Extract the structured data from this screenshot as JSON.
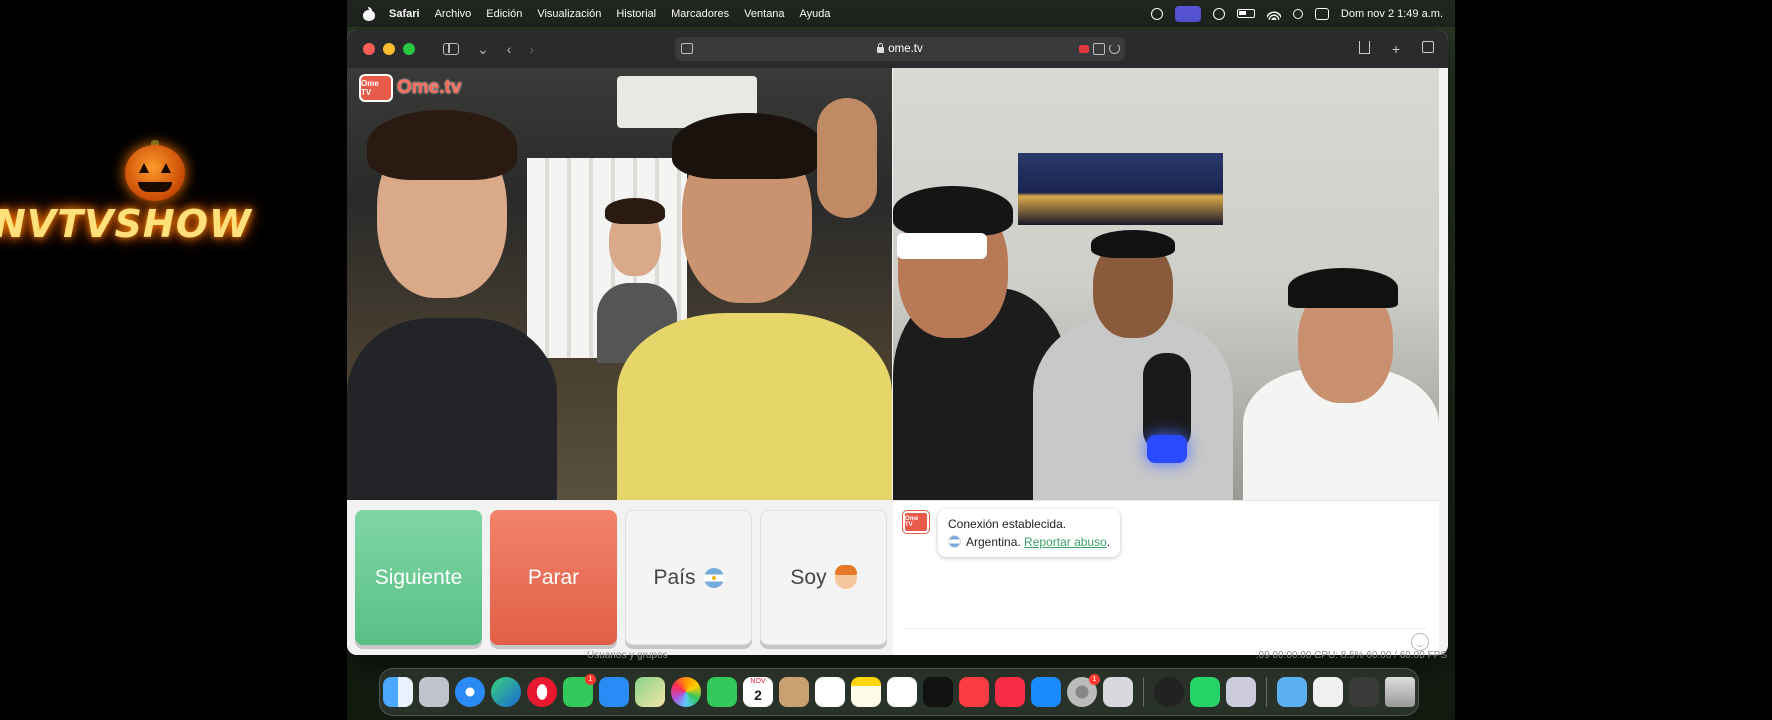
{
  "overlay": {
    "brand_text": "NVTVSHOW"
  },
  "menubar": {
    "app_name": "Safari",
    "items": [
      "Archivo",
      "Edición",
      "Visualización",
      "Historial",
      "Marcadores",
      "Ventana",
      "Ayuda"
    ],
    "datetime": "Dom nov 2  1:49 a.m."
  },
  "browser": {
    "url": "ome.tv"
  },
  "page": {
    "logo_text": "Ome.tv",
    "logo_tv_text": "Ome TV",
    "buttons": {
      "next": "Siguiente",
      "stop": "Parar",
      "country": "País",
      "gender": "Soy"
    },
    "chat": {
      "status": "Conexión establecida.",
      "country": "Argentina.",
      "report_link": "Reportar abuso",
      "report_suffix": "."
    }
  },
  "behind": {
    "left": "Usuarios y grupos",
    "right": ".09     00:00:00     CPU: 8.5%     60.00 / 60.00 FPS"
  },
  "dock": {
    "messages_badge": "1",
    "calendar_month": "NOV",
    "calendar_day": "2",
    "settings_badge": "1"
  },
  "colors": {
    "next": "#59bf86",
    "stop": "#e15f47",
    "link": "#3aa06a"
  }
}
